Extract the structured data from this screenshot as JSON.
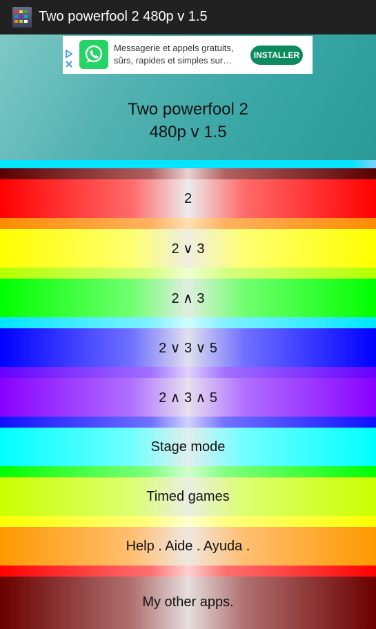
{
  "titlebar": {
    "title": "Two powerfool 2 480p v 1.5",
    "icon": "app-icon"
  },
  "ad": {
    "choice_icon": "adchoices-icon",
    "logo_icon": "whatsapp-icon",
    "line1": "Messagerie et appels gratuits,",
    "line2": "sûrs, rapides et simples sur…",
    "install_label": "INSTALLER"
  },
  "header": {
    "line1": "Two powerfool 2",
    "line2": "480p v 1.5"
  },
  "menu": {
    "items": [
      {
        "label": "2"
      },
      {
        "label": "2 ∨ 3"
      },
      {
        "label": "2 ∧ 3"
      },
      {
        "label": "2 ∨ 3 ∨ 5"
      },
      {
        "label": "2 ∧ 3 ∧ 5"
      },
      {
        "label": "Stage mode"
      },
      {
        "label": "Timed games"
      },
      {
        "label": "Help . Aide . Ayuda ."
      },
      {
        "label": "My other apps."
      }
    ]
  },
  "colors": {
    "red": "#ff0000",
    "yellow": "#ffff00",
    "green": "#00ff00",
    "blue": "#0000ff",
    "violet": "#8800ff",
    "cyan": "#00ffff",
    "lime": "#ccff00",
    "orange": "#ff9900",
    "maroon": "#6b0000",
    "header_teal": "#3aa7a6",
    "ad_button": "#0d8b5e"
  }
}
